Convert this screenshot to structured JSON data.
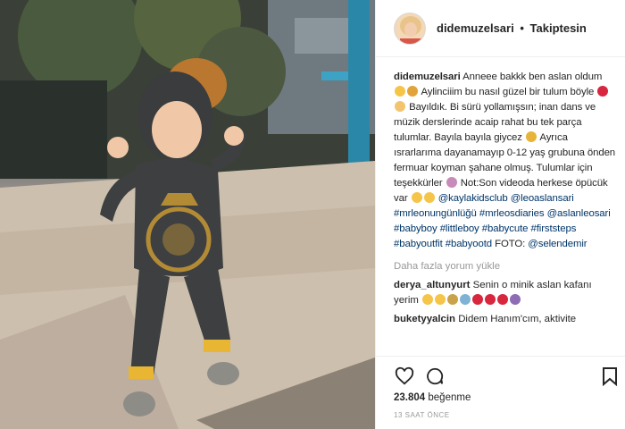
{
  "post": {
    "username": "didemuzelsari",
    "separator": "•",
    "follow_status": "Takiptesin",
    "caption_parts": {
      "p1": "Anneee bakkk ben aslan oldum",
      "p2": "Aylinciiim bu nasıl güzel bir tulum böyle",
      "p3": "Bayıldık. Bi sürü yollamışsın; inan dans ve müzik derslerinde acaip rahat bu tek parça tulumlar. Bayıla bayıla giycez",
      "p4": "Ayrıca ısrarlarıma dayanamayıp 0-12 yaş grubuna önden fermuar koyman şahane olmuş. Tulumlar için teşekkürler",
      "p5": "Not:Son videoda herkese öpücük var",
      "mention1": "@kaylakidsclub",
      "mention2": "@leoaslansari",
      "tag1": "#mrleonungünlüğü",
      "tag2": "#mrleosdiaries",
      "mention3": "@aslanleosari",
      "tag3": "#babyboy",
      "tag4": "#littleboy",
      "tag5": "#babycute",
      "tag6": "#firststeps",
      "tag7": "#babyoutfit",
      "tag8": "#babyootd",
      "foto": "FOTO:",
      "mention4": "@selendemir"
    },
    "load_more": "Daha fazla yorum yükle",
    "comments": [
      {
        "user": "derya_altunyurt",
        "text": "Senin o minik aslan kafanı yerim"
      },
      {
        "user": "buketyyalcin",
        "text": "Didem Hanım'cım, aktivite"
      }
    ],
    "likes_count": "23.804",
    "likes_word": "beğenme",
    "time_ago": "13 SAAT ÖNCE"
  },
  "icons": {
    "like": "heart-icon",
    "comment": "comment-bubble-icon",
    "save": "bookmark-icon"
  },
  "colors": {
    "link": "#003569",
    "muted": "#999999",
    "text": "#262626",
    "border": "#efefef"
  }
}
